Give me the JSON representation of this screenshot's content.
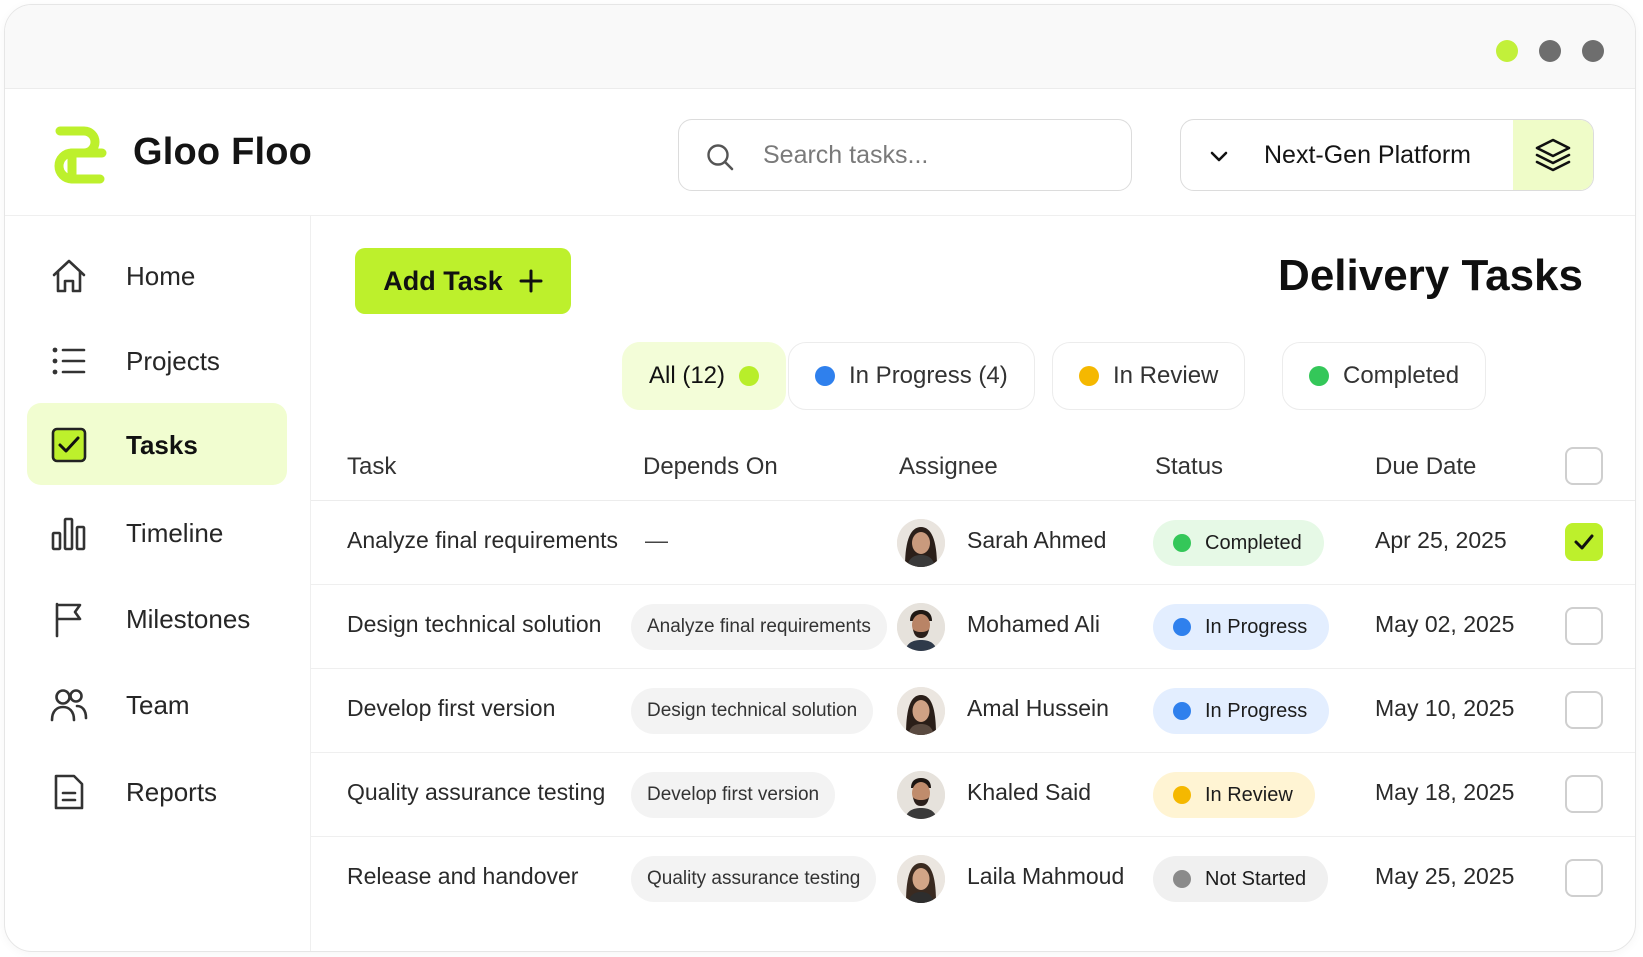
{
  "window": {
    "controls": [
      {
        "name": "window-dot-green",
        "color": "#c2f03a"
      },
      {
        "name": "window-dot-gray",
        "color": "#6e6e6e"
      },
      {
        "name": "window-dot-gray-2",
        "color": "#6e6e6e"
      }
    ]
  },
  "brand": {
    "name": "Gloo Floo",
    "accent": "#bdf02c",
    "logo_icon": "gloo-floo-logo-icon"
  },
  "search": {
    "placeholder": "Search tasks...",
    "value": "",
    "icon": "search-icon"
  },
  "project_selector": {
    "label": "Next-Gen Platform",
    "icon": "layers-icon",
    "chevron": "chevron-down-icon"
  },
  "sidebar": {
    "items": [
      {
        "label": "Home",
        "icon": "home-icon",
        "active": false
      },
      {
        "label": "Projects",
        "icon": "list-icon",
        "active": false
      },
      {
        "label": "Tasks",
        "icon": "checkbox-icon",
        "active": true
      },
      {
        "label": "Timeline",
        "icon": "bar-chart-icon",
        "active": false
      },
      {
        "label": "Milestones",
        "icon": "flag-icon",
        "active": false
      },
      {
        "label": "Team",
        "icon": "users-icon",
        "active": false
      },
      {
        "label": "Reports",
        "icon": "document-icon",
        "active": false
      }
    ]
  },
  "toolbar": {
    "add_label": "Add Task",
    "add_icon": "plus-icon"
  },
  "page": {
    "title": "Delivery Tasks"
  },
  "filters": [
    {
      "label": "All (12)",
      "color": "#b8ee2a",
      "active": true
    },
    {
      "label": "In Progress (4)",
      "color": "#2f80ed",
      "active": false
    },
    {
      "label": "In Review",
      "color": "#f5b800",
      "active": false
    },
    {
      "label": "Completed",
      "color": "#34c759",
      "active": false
    }
  ],
  "table": {
    "columns": [
      "Task",
      "Depends On",
      "Assignee",
      "Status",
      "Due Date"
    ],
    "rows": [
      {
        "task": "Analyze final requirements",
        "depends_on": "—",
        "assignee": "Sarah Ahmed",
        "status": "Completed",
        "due": "Apr 25, 2025",
        "checked": true
      },
      {
        "task": "Design technical solution",
        "depends_on": "Analyze final requirements",
        "assignee": "Mohamed Ali",
        "status": "In Progress",
        "due": "May 02, 2025",
        "checked": false
      },
      {
        "task": "Develop first version",
        "depends_on": "Design technical solution",
        "assignee": "Amal Hussein",
        "status": "In Progress",
        "due": "May 10, 2025",
        "checked": false
      },
      {
        "task": "Quality assurance testing",
        "depends_on": "Develop first version",
        "assignee": "Khaled Said",
        "status": "In Review",
        "due": "May 18, 2025",
        "checked": false
      },
      {
        "task": "Release and handover",
        "depends_on": "Quality assurance testing",
        "assignee": "Laila Mahmoud",
        "status": "Not Started",
        "due": "May 25, 2025",
        "checked": false
      }
    ]
  },
  "status_styles": {
    "Completed": {
      "bg": "#e6f9e6",
      "dot": "#34c759"
    },
    "In Progress": {
      "bg": "#e3eeff",
      "dot": "#2f80ed"
    },
    "In Review": {
      "bg": "#fff4d3",
      "dot": "#f5b800"
    },
    "Not Started": {
      "bg": "#f0f0f0",
      "dot": "#8a8a8a"
    }
  }
}
